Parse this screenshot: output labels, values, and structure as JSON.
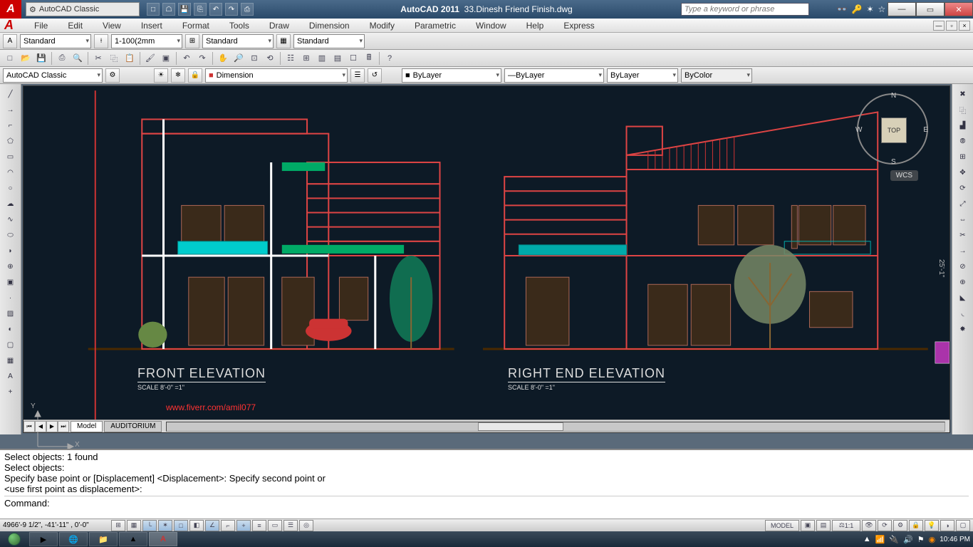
{
  "titlebar": {
    "workspace": "AutoCAD Classic",
    "app": "AutoCAD 2011",
    "file": "33.Dinesh Friend Finish.dwg",
    "search_placeholder": "Type a keyword or phrase"
  },
  "menu": [
    "File",
    "Edit",
    "View",
    "Insert",
    "Format",
    "Tools",
    "Draw",
    "Dimension",
    "Modify",
    "Parametric",
    "Window",
    "Help",
    "Express"
  ],
  "stylebar": {
    "textstyle": "Standard",
    "dimscale": "1-100(2mm",
    "dimstyle": "Standard",
    "tablestyle": "Standard"
  },
  "propbar": {
    "workspace": "AutoCAD Classic",
    "layer": "Dimension",
    "linetype": "ByLayer",
    "lineweight": "ByLayer",
    "plotstyle": "ByLayer",
    "color": "ByColor"
  },
  "canvas": {
    "front": {
      "title": "FRONT ELEVATION",
      "scale": "SCALE  8'-0\" =1\""
    },
    "right": {
      "title": "RIGHT END ELEVATION",
      "scale": "SCALE  8'-0\" =1\""
    },
    "url": "www.fiverr.com/amil077",
    "viewcube": {
      "top": "TOP",
      "n": "N",
      "s": "S",
      "e": "E",
      "w": "W"
    },
    "wcs": "WCS",
    "dimension": "25'-1\"",
    "ucs": {
      "x": "X",
      "y": "Y"
    }
  },
  "layouttabs": {
    "model": "Model",
    "layout1": "AUDITORIUM"
  },
  "command": {
    "l1": "Select objects: 1 found",
    "l2": "Select objects:",
    "l3": "Specify base point or [Displacement] <Displacement>: Specify second point or",
    "l4": "<use first point as displacement>:",
    "prompt": "Command:"
  },
  "statusbar": {
    "coords": "4966'-9 1/2\", -41'-11\" , 0'-0\"",
    "model": "MODEL",
    "scale": "1:1"
  },
  "taskbar": {
    "time": "10:46 PM"
  }
}
